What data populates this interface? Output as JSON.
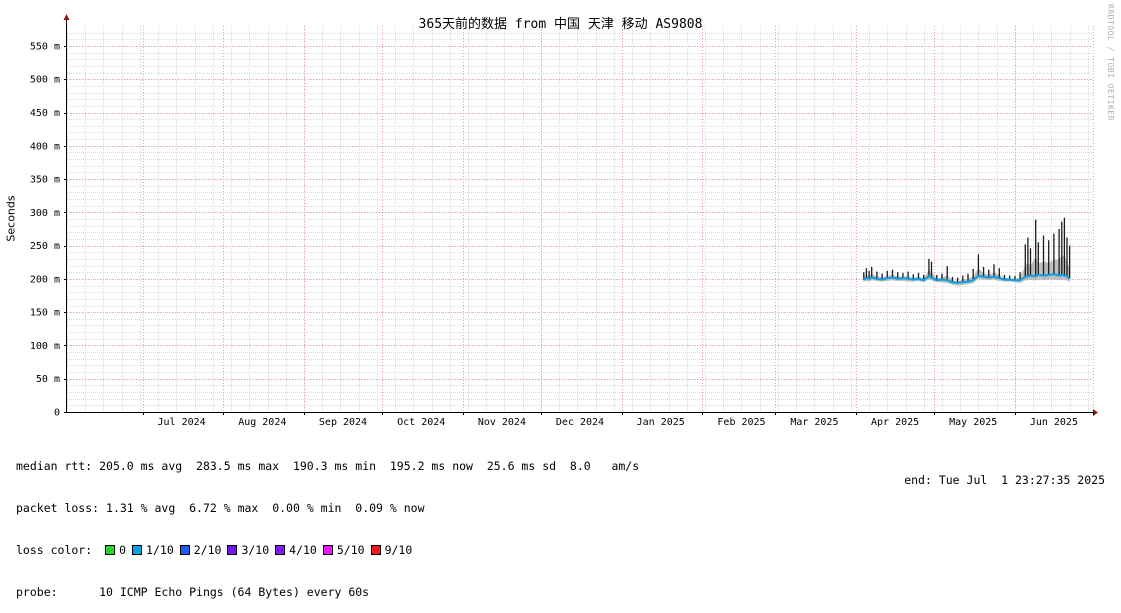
{
  "watermark": "RRDTOOL / TOBI OETIKER",
  "chart_data": {
    "type": "line",
    "title": "365天前的数据 from 中国 天津 移动 AS9808",
    "ylabel": "Seconds",
    "ylim": [
      0,
      0.58
    ],
    "y_ticks": [
      {
        "value": 0,
        "label": "0"
      },
      {
        "value": 0.05,
        "label": "50 m"
      },
      {
        "value": 0.1,
        "label": "100 m"
      },
      {
        "value": 0.15,
        "label": "150 m"
      },
      {
        "value": 0.2,
        "label": "200 m"
      },
      {
        "value": 0.25,
        "label": "250 m"
      },
      {
        "value": 0.3,
        "label": "300 m"
      },
      {
        "value": 0.35,
        "label": "350 m"
      },
      {
        "value": 0.4,
        "label": "400 m"
      },
      {
        "value": 0.45,
        "label": "450 m"
      },
      {
        "value": 0.5,
        "label": "500 m"
      },
      {
        "value": 0.55,
        "label": "550 m"
      }
    ],
    "x_range": [
      "2024-06-02",
      "2025-07-01"
    ],
    "x_ticks": [
      {
        "label": "Jul 2024",
        "date": "2024-07-16"
      },
      {
        "label": "Aug 2024",
        "date": "2024-08-16"
      },
      {
        "label": "Sep 2024",
        "date": "2024-09-16"
      },
      {
        "label": "Oct 2024",
        "date": "2024-10-16"
      },
      {
        "label": "Nov 2024",
        "date": "2024-11-16"
      },
      {
        "label": "Dec 2024",
        "date": "2024-12-16"
      },
      {
        "label": "Jan 2025",
        "date": "2025-01-16"
      },
      {
        "label": "Feb 2025",
        "date": "2025-02-16"
      },
      {
        "label": "Mar 2025",
        "date": "2025-03-16"
      },
      {
        "label": "Apr 2025",
        "date": "2025-04-16"
      },
      {
        "label": "May 2025",
        "date": "2025-05-16"
      },
      {
        "label": "Jun 2025",
        "date": "2025-06-16"
      }
    ],
    "month_boundaries": [
      "2024-07-01",
      "2024-08-01",
      "2024-09-01",
      "2024-10-01",
      "2024-11-01",
      "2024-12-01",
      "2025-01-01",
      "2025-02-01",
      "2025-03-01",
      "2025-04-01",
      "2025-05-01",
      "2025-06-01",
      "2025-07-01"
    ],
    "grid": true,
    "series": [
      {
        "name": "median rtt",
        "color": "#0aa0e8",
        "points": [
          {
            "date": "2025-04-04",
            "median": 0.199,
            "max": 0.21,
            "min": 0.196
          },
          {
            "date": "2025-04-05",
            "median": 0.201,
            "max": 0.216,
            "min": 0.197
          },
          {
            "date": "2025-04-06",
            "median": 0.2,
            "max": 0.212,
            "min": 0.196
          },
          {
            "date": "2025-04-07",
            "median": 0.202,
            "max": 0.218,
            "min": 0.198
          },
          {
            "date": "2025-04-09",
            "median": 0.2,
            "max": 0.211,
            "min": 0.197
          },
          {
            "date": "2025-04-11",
            "median": 0.199,
            "max": 0.208,
            "min": 0.196
          },
          {
            "date": "2025-04-13",
            "median": 0.201,
            "max": 0.212,
            "min": 0.197
          },
          {
            "date": "2025-04-15",
            "median": 0.202,
            "max": 0.214,
            "min": 0.198
          },
          {
            "date": "2025-04-17",
            "median": 0.2,
            "max": 0.21,
            "min": 0.197
          },
          {
            "date": "2025-04-19",
            "median": 0.201,
            "max": 0.209,
            "min": 0.197
          },
          {
            "date": "2025-04-21",
            "median": 0.2,
            "max": 0.211,
            "min": 0.196
          },
          {
            "date": "2025-04-23",
            "median": 0.199,
            "max": 0.207,
            "min": 0.196
          },
          {
            "date": "2025-04-25",
            "median": 0.2,
            "max": 0.209,
            "min": 0.197
          },
          {
            "date": "2025-04-27",
            "median": 0.198,
            "max": 0.206,
            "min": 0.195
          },
          {
            "date": "2025-04-29",
            "median": 0.204,
            "max": 0.23,
            "min": 0.199
          },
          {
            "date": "2025-04-30",
            "median": 0.202,
            "max": 0.226,
            "min": 0.198
          },
          {
            "date": "2025-05-02",
            "median": 0.198,
            "max": 0.206,
            "min": 0.195
          },
          {
            "date": "2025-05-04",
            "median": 0.199,
            "max": 0.208,
            "min": 0.195
          },
          {
            "date": "2025-05-06",
            "median": 0.198,
            "max": 0.219,
            "min": 0.194
          },
          {
            "date": "2025-05-08",
            "median": 0.195,
            "max": 0.203,
            "min": 0.191
          },
          {
            "date": "2025-05-10",
            "median": 0.194,
            "max": 0.202,
            "min": 0.19
          },
          {
            "date": "2025-05-12",
            "median": 0.195,
            "max": 0.205,
            "min": 0.191
          },
          {
            "date": "2025-05-14",
            "median": 0.196,
            "max": 0.208,
            "min": 0.192
          },
          {
            "date": "2025-05-16",
            "median": 0.198,
            "max": 0.215,
            "min": 0.194
          },
          {
            "date": "2025-05-18",
            "median": 0.205,
            "max": 0.237,
            "min": 0.2
          },
          {
            "date": "2025-05-20",
            "median": 0.203,
            "max": 0.218,
            "min": 0.199
          },
          {
            "date": "2025-05-22",
            "median": 0.202,
            "max": 0.214,
            "min": 0.198
          },
          {
            "date": "2025-05-24",
            "median": 0.203,
            "max": 0.222,
            "min": 0.199
          },
          {
            "date": "2025-05-26",
            "median": 0.201,
            "max": 0.216,
            "min": 0.197
          },
          {
            "date": "2025-05-28",
            "median": 0.199,
            "max": 0.206,
            "min": 0.196
          },
          {
            "date": "2025-05-30",
            "median": 0.199,
            "max": 0.205,
            "min": 0.196
          },
          {
            "date": "2025-06-01",
            "median": 0.198,
            "max": 0.204,
            "min": 0.195
          },
          {
            "date": "2025-06-03",
            "median": 0.198,
            "max": 0.21,
            "min": 0.194
          },
          {
            "date": "2025-06-05",
            "median": 0.203,
            "max": 0.252,
            "min": 0.198
          },
          {
            "date": "2025-06-06",
            "median": 0.204,
            "max": 0.262,
            "min": 0.198
          },
          {
            "date": "2025-06-07",
            "median": 0.205,
            "max": 0.246,
            "min": 0.199
          },
          {
            "date": "2025-06-09",
            "median": 0.204,
            "max": 0.289,
            "min": 0.198
          },
          {
            "date": "2025-06-10",
            "median": 0.206,
            "max": 0.255,
            "min": 0.199
          },
          {
            "date": "2025-06-12",
            "median": 0.205,
            "max": 0.265,
            "min": 0.198
          },
          {
            "date": "2025-06-14",
            "median": 0.206,
            "max": 0.258,
            "min": 0.199
          },
          {
            "date": "2025-06-16",
            "median": 0.207,
            "max": 0.268,
            "min": 0.199
          },
          {
            "date": "2025-06-18",
            "median": 0.205,
            "max": 0.275,
            "min": 0.198
          },
          {
            "date": "2025-06-19",
            "median": 0.206,
            "max": 0.286,
            "min": 0.199
          },
          {
            "date": "2025-06-20",
            "median": 0.205,
            "max": 0.292,
            "min": 0.198
          },
          {
            "date": "2025-06-21",
            "median": 0.204,
            "max": 0.262,
            "min": 0.198
          },
          {
            "date": "2025-06-22",
            "median": 0.2,
            "max": 0.25,
            "min": 0.195
          }
        ]
      }
    ]
  },
  "legend": {
    "median_rtt": {
      "label": "median rtt:",
      "text": " 205.0 ms avg  283.5 ms max  190.3 ms min  195.2 ms now  25.6 ms sd  8.0   am/s"
    },
    "packet_loss": {
      "label": "packet loss:",
      "text": "1.31 % avg  6.72 % max  0.00 % min  0.09 % now"
    },
    "loss_color": {
      "label": "loss color:",
      "items": [
        {
          "label": "0",
          "color": "#26d626"
        },
        {
          "label": "1/10",
          "color": "#0aa0e8"
        },
        {
          "label": "2/10",
          "color": "#1c5cf0"
        },
        {
          "label": "3/10",
          "color": "#7418ec"
        },
        {
          "label": "4/10",
          "color": "#8618f0"
        },
        {
          "label": "5/10",
          "color": "#e41cf4"
        },
        {
          "label": "9/10",
          "color": "#f01818"
        }
      ]
    },
    "probe": {
      "label": "probe:",
      "text": "      10 ICMP Echo Pings (64 Bytes) every 60s"
    }
  },
  "end_time": "end: Tue Jul  1 23:27:35 2025"
}
